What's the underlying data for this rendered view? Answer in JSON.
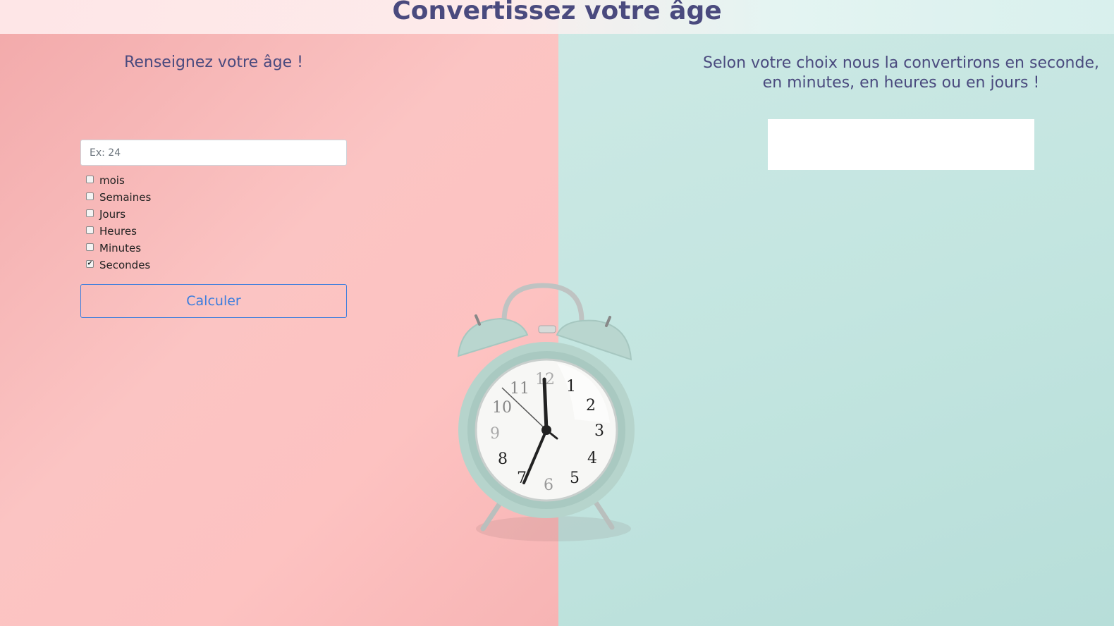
{
  "header": {
    "title": "Convertissez votre âge"
  },
  "left": {
    "heading": "Renseignez votre âge !",
    "age_input": {
      "placeholder": "Ex: 24",
      "value": ""
    },
    "options": [
      {
        "label": "mois",
        "checked": false
      },
      {
        "label": "Semaines",
        "checked": false
      },
      {
        "label": "Jours",
        "checked": false
      },
      {
        "label": "Heures",
        "checked": false
      },
      {
        "label": "Minutes",
        "checked": false
      },
      {
        "label": "Secondes",
        "checked": true
      }
    ],
    "calc_button_label": "Calculer"
  },
  "right": {
    "heading_line1": "Selon votre choix nous la convertirons en seconde,",
    "heading_line2": "en minutes, en heures ou en jours !",
    "result_value": ""
  },
  "clock": {
    "numbers": [
      "12",
      "1",
      "2",
      "3",
      "4",
      "5",
      "6",
      "7",
      "8",
      "9",
      "10",
      "11"
    ]
  },
  "colors": {
    "left_bg": "#fbc4c3",
    "right_bg": "#c3e5e0",
    "title_color": "#4a4a7e",
    "button_accent": "#3b7ddd",
    "clock_body": "#b6d4cc"
  }
}
